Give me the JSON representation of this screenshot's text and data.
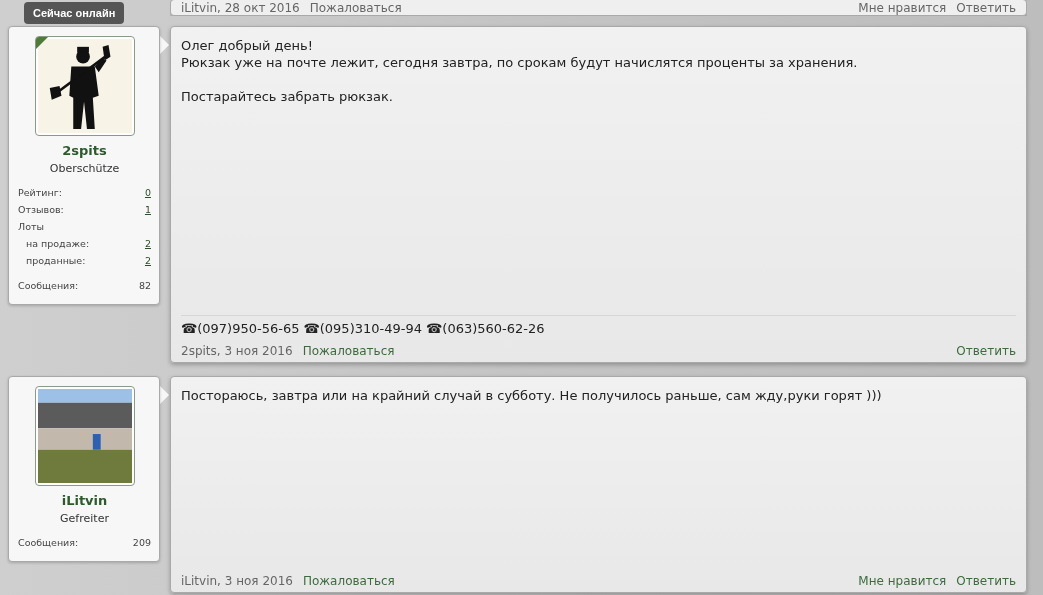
{
  "previous_post_footer": {
    "meta": "iLitvin, 28 окт 2016",
    "report": "Пожаловаться",
    "like": "Мне нравится",
    "reply": "Ответить"
  },
  "online_tooltip": "Сейчас онлайн",
  "posts": [
    {
      "user": {
        "name": "2spits",
        "rank": "Oberschütze",
        "online": true,
        "stats": [
          {
            "kind": "stat",
            "label": "Рейтинг:",
            "value": "0"
          },
          {
            "kind": "stat",
            "label": "Отзывов:",
            "value": "1"
          },
          {
            "kind": "heading",
            "label": "Лоты"
          },
          {
            "kind": "sub",
            "label": "на продаже:",
            "value": "2"
          },
          {
            "kind": "sub",
            "label": "проданные:",
            "value": "2"
          },
          {
            "kind": "count",
            "label": "Сообщения:",
            "value": "82"
          }
        ]
      },
      "message": {
        "paragraphs": [
          "Олег добрый день!\nРюкзак уже на почте лежит, сегодня завтра, по срокам будут начислятся проценты за хранения.",
          "Постарайтесь забрать рюкзак."
        ],
        "signature": "☎(097)950-56-65 ☎(095)310-49-94 ☎(063)560-62-26",
        "meta": "2spits, 3 ноя 2016",
        "report": "Пожаловаться",
        "reply": "Ответить"
      }
    },
    {
      "user": {
        "name": "iLitvin",
        "rank": "Gefreiter",
        "online": false,
        "stats": [
          {
            "kind": "count",
            "label": "Сообщения:",
            "value": "209"
          }
        ]
      },
      "message": {
        "paragraphs": [
          "Постораюсь, завтра или на крайний случай в субботу. Не получилось раньше, сам жду,руки горят )))"
        ],
        "meta": "iLitvin, 3 ноя 2016",
        "report": "Пожаловаться",
        "like": "Мне нравится",
        "reply": "Ответить"
      }
    }
  ]
}
